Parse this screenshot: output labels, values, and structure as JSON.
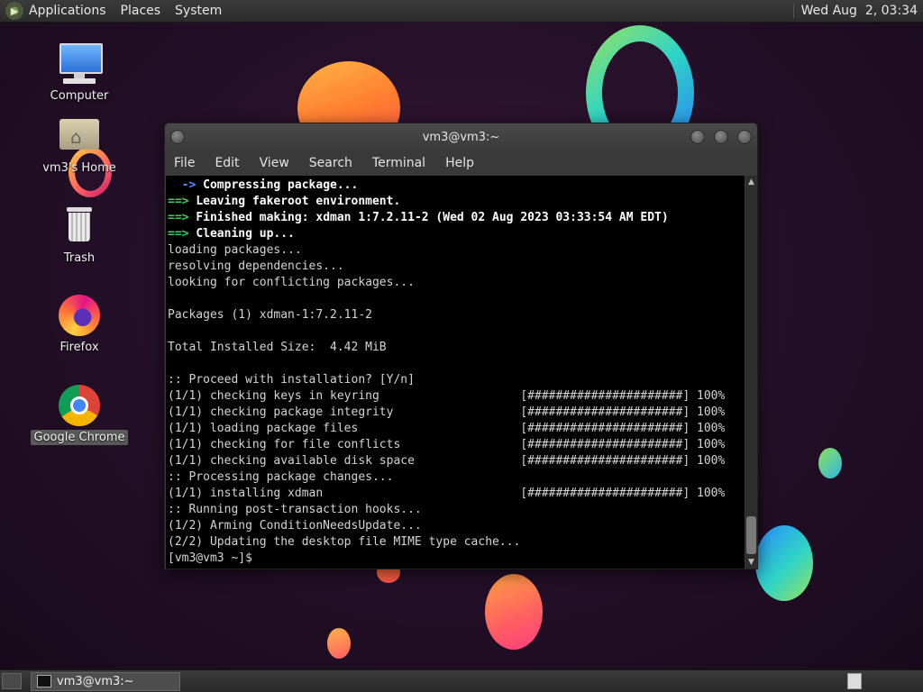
{
  "top_panel": {
    "menus": [
      "Applications",
      "Places",
      "System"
    ],
    "clock": "Wed Aug  2, 03:34"
  },
  "desktop_icons": [
    {
      "label": "Computer",
      "icon": "computer-icon"
    },
    {
      "label": "vm3's Home",
      "icon": "home-folder-icon"
    },
    {
      "label": "Trash",
      "icon": "trash-icon"
    },
    {
      "label": "Firefox",
      "icon": "firefox-icon"
    },
    {
      "label": "Google Chrome",
      "icon": "chrome-icon",
      "selected": true
    }
  ],
  "terminal": {
    "title": "vm3@vm3:~",
    "menu": [
      "File",
      "Edit",
      "View",
      "Search",
      "Terminal",
      "Help"
    ],
    "lines": [
      {
        "prefix": "  -> ",
        "prefix_style": "blue",
        "text": "Compressing package...",
        "style": "bold"
      },
      {
        "prefix": "==> ",
        "prefix_style": "green",
        "text": "Leaving fakeroot environment.",
        "style": "bold"
      },
      {
        "prefix": "==> ",
        "prefix_style": "green",
        "text": "Finished making: xdman 1:7.2.11-2 (Wed 02 Aug 2023 03:33:54 AM EDT)",
        "style": "bold"
      },
      {
        "prefix": "==> ",
        "prefix_style": "green",
        "text": "Cleaning up...",
        "style": "bold"
      },
      {
        "prefix": "",
        "text": "loading packages..."
      },
      {
        "prefix": "",
        "text": "resolving dependencies..."
      },
      {
        "prefix": "",
        "text": "looking for conflicting packages..."
      },
      {
        "prefix": "",
        "text": ""
      },
      {
        "prefix": "",
        "text": "Packages (1) xdman-1:7.2.11-2"
      },
      {
        "prefix": "",
        "text": ""
      },
      {
        "prefix": "",
        "text": "Total Installed Size:  4.42 MiB"
      },
      {
        "prefix": "",
        "text": ""
      },
      {
        "prefix": "",
        "text": ":: Proceed with installation? [Y/n]"
      },
      {
        "prefix": "",
        "text": "(1/1) checking keys in keyring                    [######################] 100%"
      },
      {
        "prefix": "",
        "text": "(1/1) checking package integrity                  [######################] 100%"
      },
      {
        "prefix": "",
        "text": "(1/1) loading package files                       [######################] 100%"
      },
      {
        "prefix": "",
        "text": "(1/1) checking for file conflicts                 [######################] 100%"
      },
      {
        "prefix": "",
        "text": "(1/1) checking available disk space               [######################] 100%"
      },
      {
        "prefix": "",
        "text": ":: Processing package changes..."
      },
      {
        "prefix": "",
        "text": "(1/1) installing xdman                            [######################] 100%"
      },
      {
        "prefix": "",
        "text": ":: Running post-transaction hooks..."
      },
      {
        "prefix": "",
        "text": "(1/2) Arming ConditionNeedsUpdate..."
      },
      {
        "prefix": "",
        "text": "(2/2) Updating the desktop file MIME type cache..."
      },
      {
        "prefix": "",
        "text": "[vm3@vm3 ~]$ "
      }
    ]
  },
  "taskbar": {
    "window_button": "vm3@vm3:~"
  }
}
